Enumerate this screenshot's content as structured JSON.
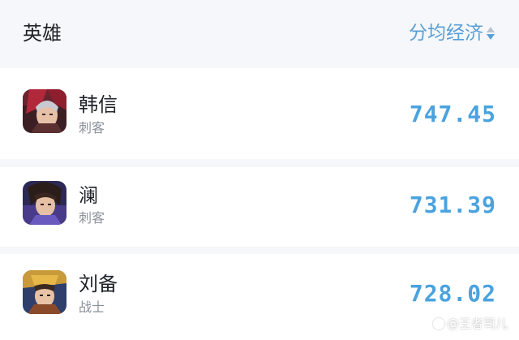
{
  "header": {
    "title": "英雄",
    "sort_label": "分均经济",
    "sort_icon": "sort-toggle-icon",
    "accent_color": "#5a9fd6"
  },
  "heroes": [
    {
      "name": "韩信",
      "role": "刺客",
      "value": "747.45",
      "avatar_icon": "hero-portrait"
    },
    {
      "name": "澜",
      "role": "刺客",
      "value": "731.39",
      "avatar_icon": "hero-portrait"
    },
    {
      "name": "刘备",
      "role": "战士",
      "value": "728.02",
      "avatar_icon": "hero-portrait"
    }
  ],
  "watermark": {
    "text": "@王者司儿"
  }
}
